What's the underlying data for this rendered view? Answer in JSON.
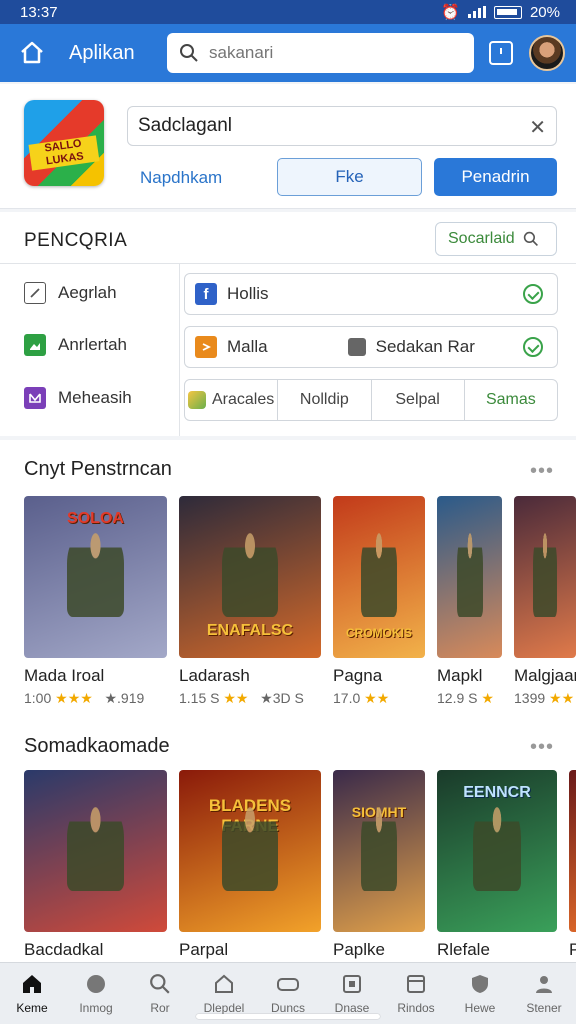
{
  "status_bar": {
    "time": "13:37",
    "battery": "20%"
  },
  "header": {
    "title": "Aplikan",
    "search_placeholder": "sakanari"
  },
  "app_details": {
    "icon_label": "SALLO LUKAS",
    "name_value": "Sadclaganl",
    "link_text": "Napdhkam",
    "secondary_button": "Fke",
    "primary_button": "Penadrin"
  },
  "settings": {
    "title": "PENCQRIA",
    "search_label": "Socarlaid",
    "side_items": [
      {
        "label": "Aegrlah",
        "icon": "edit-icon",
        "color": "#555555"
      },
      {
        "label": "Anrlertah",
        "icon": "image-icon",
        "color": "#2ea043"
      },
      {
        "label": "Meheasih",
        "icon": "email-icon",
        "color": "#7b3fb8"
      }
    ],
    "row1": {
      "label": "Hollis",
      "icon": "facebook-icon"
    },
    "row2": {
      "label": "Malla",
      "label2": "Sedakan Rar",
      "icon": "orange-app-icon"
    },
    "tabs": [
      "Aracales",
      "Nolldip",
      "Selpal",
      "Samas"
    ]
  },
  "section1": {
    "title": "Cnyt Penstrncan",
    "more": "•••",
    "games": [
      {
        "name": "Mada Iroal",
        "rating": "1:00",
        "stars": "★★★",
        "extra": "★.919",
        "thumb_text": "SOLOA",
        "colors": [
          "#5a5f8c",
          "#a3a8c8"
        ]
      },
      {
        "name": "Ladarash",
        "rating": "1.15 S",
        "stars": "★★",
        "extra": "★3D S",
        "thumb_text": "ENAFALSC",
        "colors": [
          "#2d2a3a",
          "#d2692a"
        ]
      },
      {
        "name": "Pagna",
        "rating": "17.0",
        "stars": "★★",
        "extra": "",
        "thumb_text": "CROMOKIS",
        "colors": [
          "#c23a1a",
          "#f2b24a"
        ]
      },
      {
        "name": "Mapkl",
        "rating": "12.9 S",
        "stars": "★",
        "extra": "",
        "thumb_text": "",
        "colors": [
          "#2a5a8a",
          "#d88a5a"
        ]
      },
      {
        "name": "Malgjaar",
        "rating": "1399",
        "stars": "★★",
        "extra": "",
        "thumb_text": "",
        "colors": [
          "#4a2a3a",
          "#e07a4a"
        ]
      }
    ]
  },
  "section2": {
    "title": "Somadkaomade",
    "more": "•••",
    "games": [
      {
        "name": "Bacdadkal",
        "thumb_text": "",
        "colors": [
          "#2a3a6a",
          "#d04a3a"
        ]
      },
      {
        "name": "Parpal",
        "thumb_text": "BLADENS FARNE",
        "colors": [
          "#8a1a0a",
          "#f2a22a"
        ]
      },
      {
        "name": "Paplke",
        "thumb_text": "SIOMHT",
        "colors": [
          "#3a2a4a",
          "#e0a04a"
        ]
      },
      {
        "name": "Rlefale",
        "thumb_text": "EENNCR",
        "colors": [
          "#1a3a2a",
          "#3aa05a"
        ]
      },
      {
        "name": "P",
        "thumb_text": "",
        "colors": [
          "#6a1a1a",
          "#e06a2a"
        ]
      }
    ]
  },
  "bottom_nav": [
    {
      "label": "Keme",
      "icon": "home-icon",
      "active": true
    },
    {
      "label": "Inmog",
      "icon": "globe-icon",
      "active": false
    },
    {
      "label": "Ror",
      "icon": "search-icon",
      "active": false
    },
    {
      "label": "Dlepdel",
      "icon": "house-icon",
      "active": false
    },
    {
      "label": "Duncs",
      "icon": "gamepad-icon",
      "active": false
    },
    {
      "label": "Dnase",
      "icon": "card-icon",
      "active": false
    },
    {
      "label": "Rindos",
      "icon": "window-icon",
      "active": false
    },
    {
      "label": "Hewe",
      "icon": "shield-icon",
      "active": false
    },
    {
      "label": "Stener",
      "icon": "user-icon",
      "active": false
    }
  ]
}
